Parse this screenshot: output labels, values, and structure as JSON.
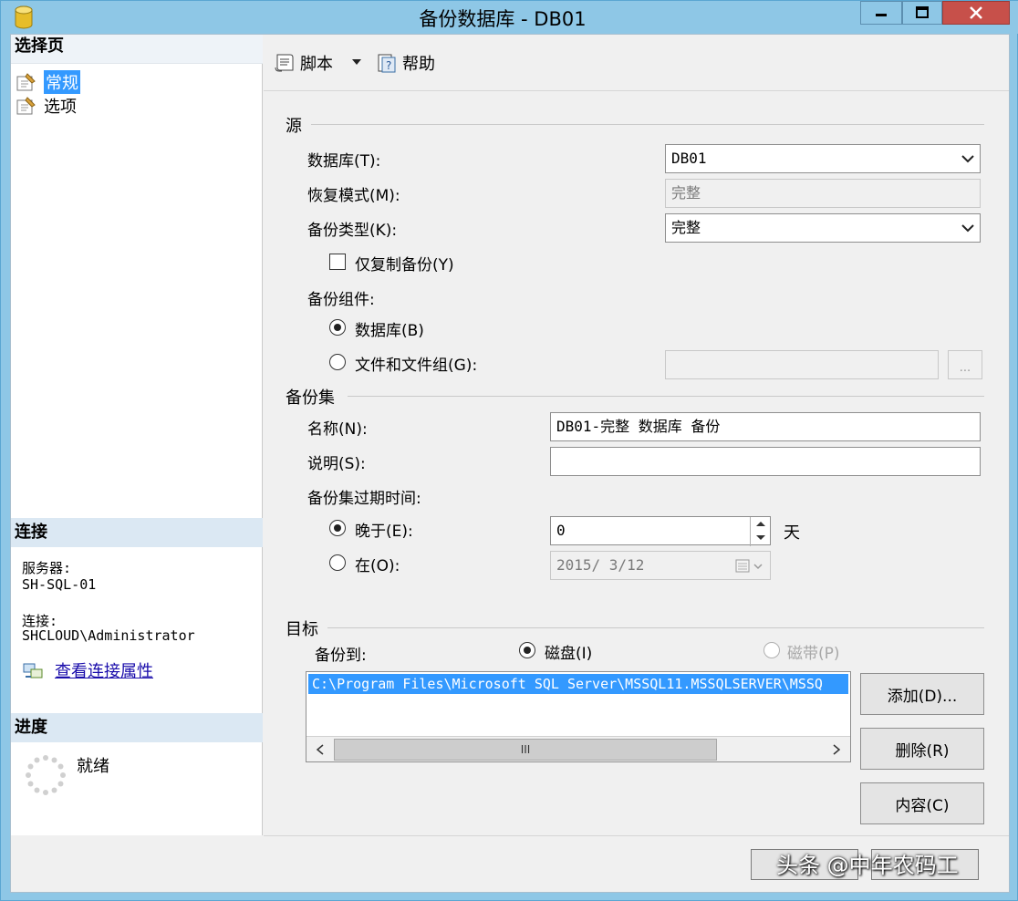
{
  "window": {
    "title": "备份数据库 - DB01"
  },
  "sidebar": {
    "pages_header": "选择页",
    "pages": [
      {
        "label": "常规",
        "selected": true
      },
      {
        "label": "选项",
        "selected": false
      }
    ],
    "connection_header": "连接",
    "server_label": "服务器:",
    "server_value": "SH-SQL-01",
    "connection_label": "连接:",
    "connection_value": "SHCLOUD\\Administrator",
    "view_connection_link": "查看连接属性",
    "progress_header": "进度",
    "progress_status": "就绪"
  },
  "toolbar": {
    "script_label": "脚本",
    "help_label": "帮助"
  },
  "source": {
    "group_label": "源",
    "database_label": "数据库(T):",
    "database_value": "DB01",
    "recovery_model_label": "恢复模式(M):",
    "recovery_model_value": "完整",
    "backup_type_label": "备份类型(K):",
    "backup_type_value": "完整",
    "copy_only_label": "仅复制备份(Y)",
    "copy_only_checked": false,
    "component_label": "备份组件:",
    "component_database_label": "数据库(B)",
    "component_files_label": "文件和文件组(G):",
    "component_selected": "数据库(B)",
    "files_value": "",
    "browse_label": "..."
  },
  "backup_set": {
    "group_label": "备份集",
    "name_label": "名称(N):",
    "name_value": "DB01-完整 数据库 备份",
    "description_label": "说明(S):",
    "description_value": "",
    "expiration_label": "备份集过期时间:",
    "after_label": "晚于(E):",
    "after_value": "0",
    "after_unit": "天",
    "on_label": "在(O):",
    "on_value": "2015/ 3/12",
    "expiration_selected": "晚于(E):"
  },
  "destination": {
    "group_label": "目标",
    "backup_to_label": "备份到:",
    "disk_label": "磁盘(I)",
    "tape_label": "磁带(P)",
    "selected": "磁盘(I)",
    "paths": [
      "C:\\Program Files\\Microsoft SQL Server\\MSSQL11.MSSQLSERVER\\MSSQ"
    ],
    "scroll_thumb": "III",
    "add_button": "添加(D)...",
    "remove_button": "删除(R)",
    "contents_button": "内容(C)"
  },
  "footer": {
    "ok_button": "",
    "cancel_button": ""
  },
  "watermark": "头条 @中年农码工",
  "colors": {
    "title_bar": "#8ec7e6",
    "close_button": "#c7504a",
    "selection": "#3399ff",
    "section_header": "#dbe8f3",
    "link": "#1a0dab"
  }
}
